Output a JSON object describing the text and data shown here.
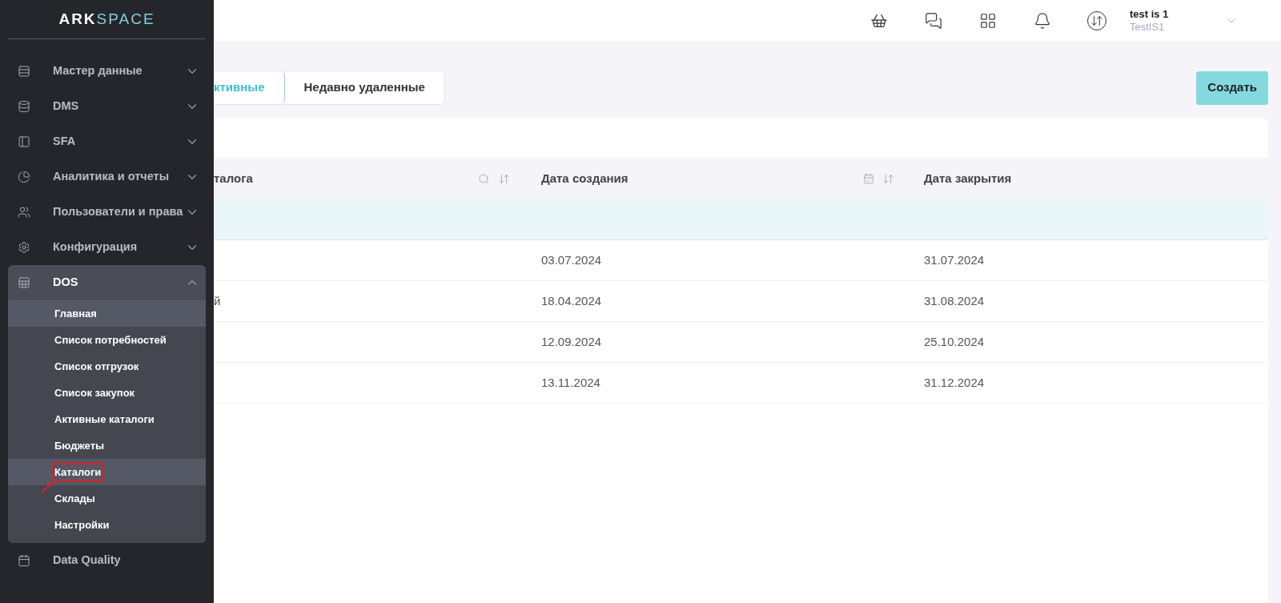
{
  "sidebar": {
    "logo": {
      "dark_part": "ARK",
      "accent_part": "SPACE"
    },
    "items": [
      {
        "label": "Мастер данные",
        "expanded": false
      },
      {
        "label": "DMS",
        "expanded": false
      },
      {
        "label": "SFA",
        "expanded": false
      },
      {
        "label": "Аналитика и отчеты",
        "expanded": false
      },
      {
        "label": "Пользователи и права",
        "expanded": false
      },
      {
        "label": "Конфигурация",
        "expanded": false
      },
      {
        "label": "DOS",
        "expanded": true,
        "children": [
          {
            "label": "Главная",
            "highlighted": true,
            "annotated": false
          },
          {
            "label": "Список потребностей",
            "highlighted": false,
            "annotated": false
          },
          {
            "label": "Список отгрузок",
            "highlighted": false,
            "annotated": false
          },
          {
            "label": "Список закупок",
            "highlighted": false,
            "annotated": false
          },
          {
            "label": "Активные каталоги",
            "highlighted": false,
            "annotated": false
          },
          {
            "label": "Бюджеты",
            "highlighted": false,
            "annotated": false
          },
          {
            "label": "Каталоги",
            "highlighted": true,
            "annotated": true
          },
          {
            "label": "Склады",
            "highlighted": false,
            "annotated": false
          },
          {
            "label": "Настройки",
            "highlighted": false,
            "annotated": false
          }
        ]
      },
      {
        "label": "Data Quality"
      }
    ]
  },
  "header": {
    "user": {
      "name": "test is 1",
      "company": "TestIS1"
    }
  },
  "tabs": [
    {
      "label": "ктивные",
      "selected": true
    },
    {
      "label": "Недавно удаленные",
      "selected": false
    }
  ],
  "create_button": "Создать",
  "table": {
    "columns": [
      {
        "label": "талога",
        "kind": "search"
      },
      {
        "label": "Дата создания",
        "kind": "date"
      },
      {
        "label": "Дата закрытия",
        "kind": "plain"
      }
    ],
    "rows": [
      {
        "created": "03.07.2024",
        "closed": "31.07.2024"
      },
      {
        "name": "й",
        "created": "18.04.2024",
        "closed": "31.08.2024"
      },
      {
        "created": "12.09.2024",
        "closed": "25.10.2024"
      },
      {
        "created": "13.11.2024",
        "closed": "31.12.2024"
      }
    ]
  }
}
